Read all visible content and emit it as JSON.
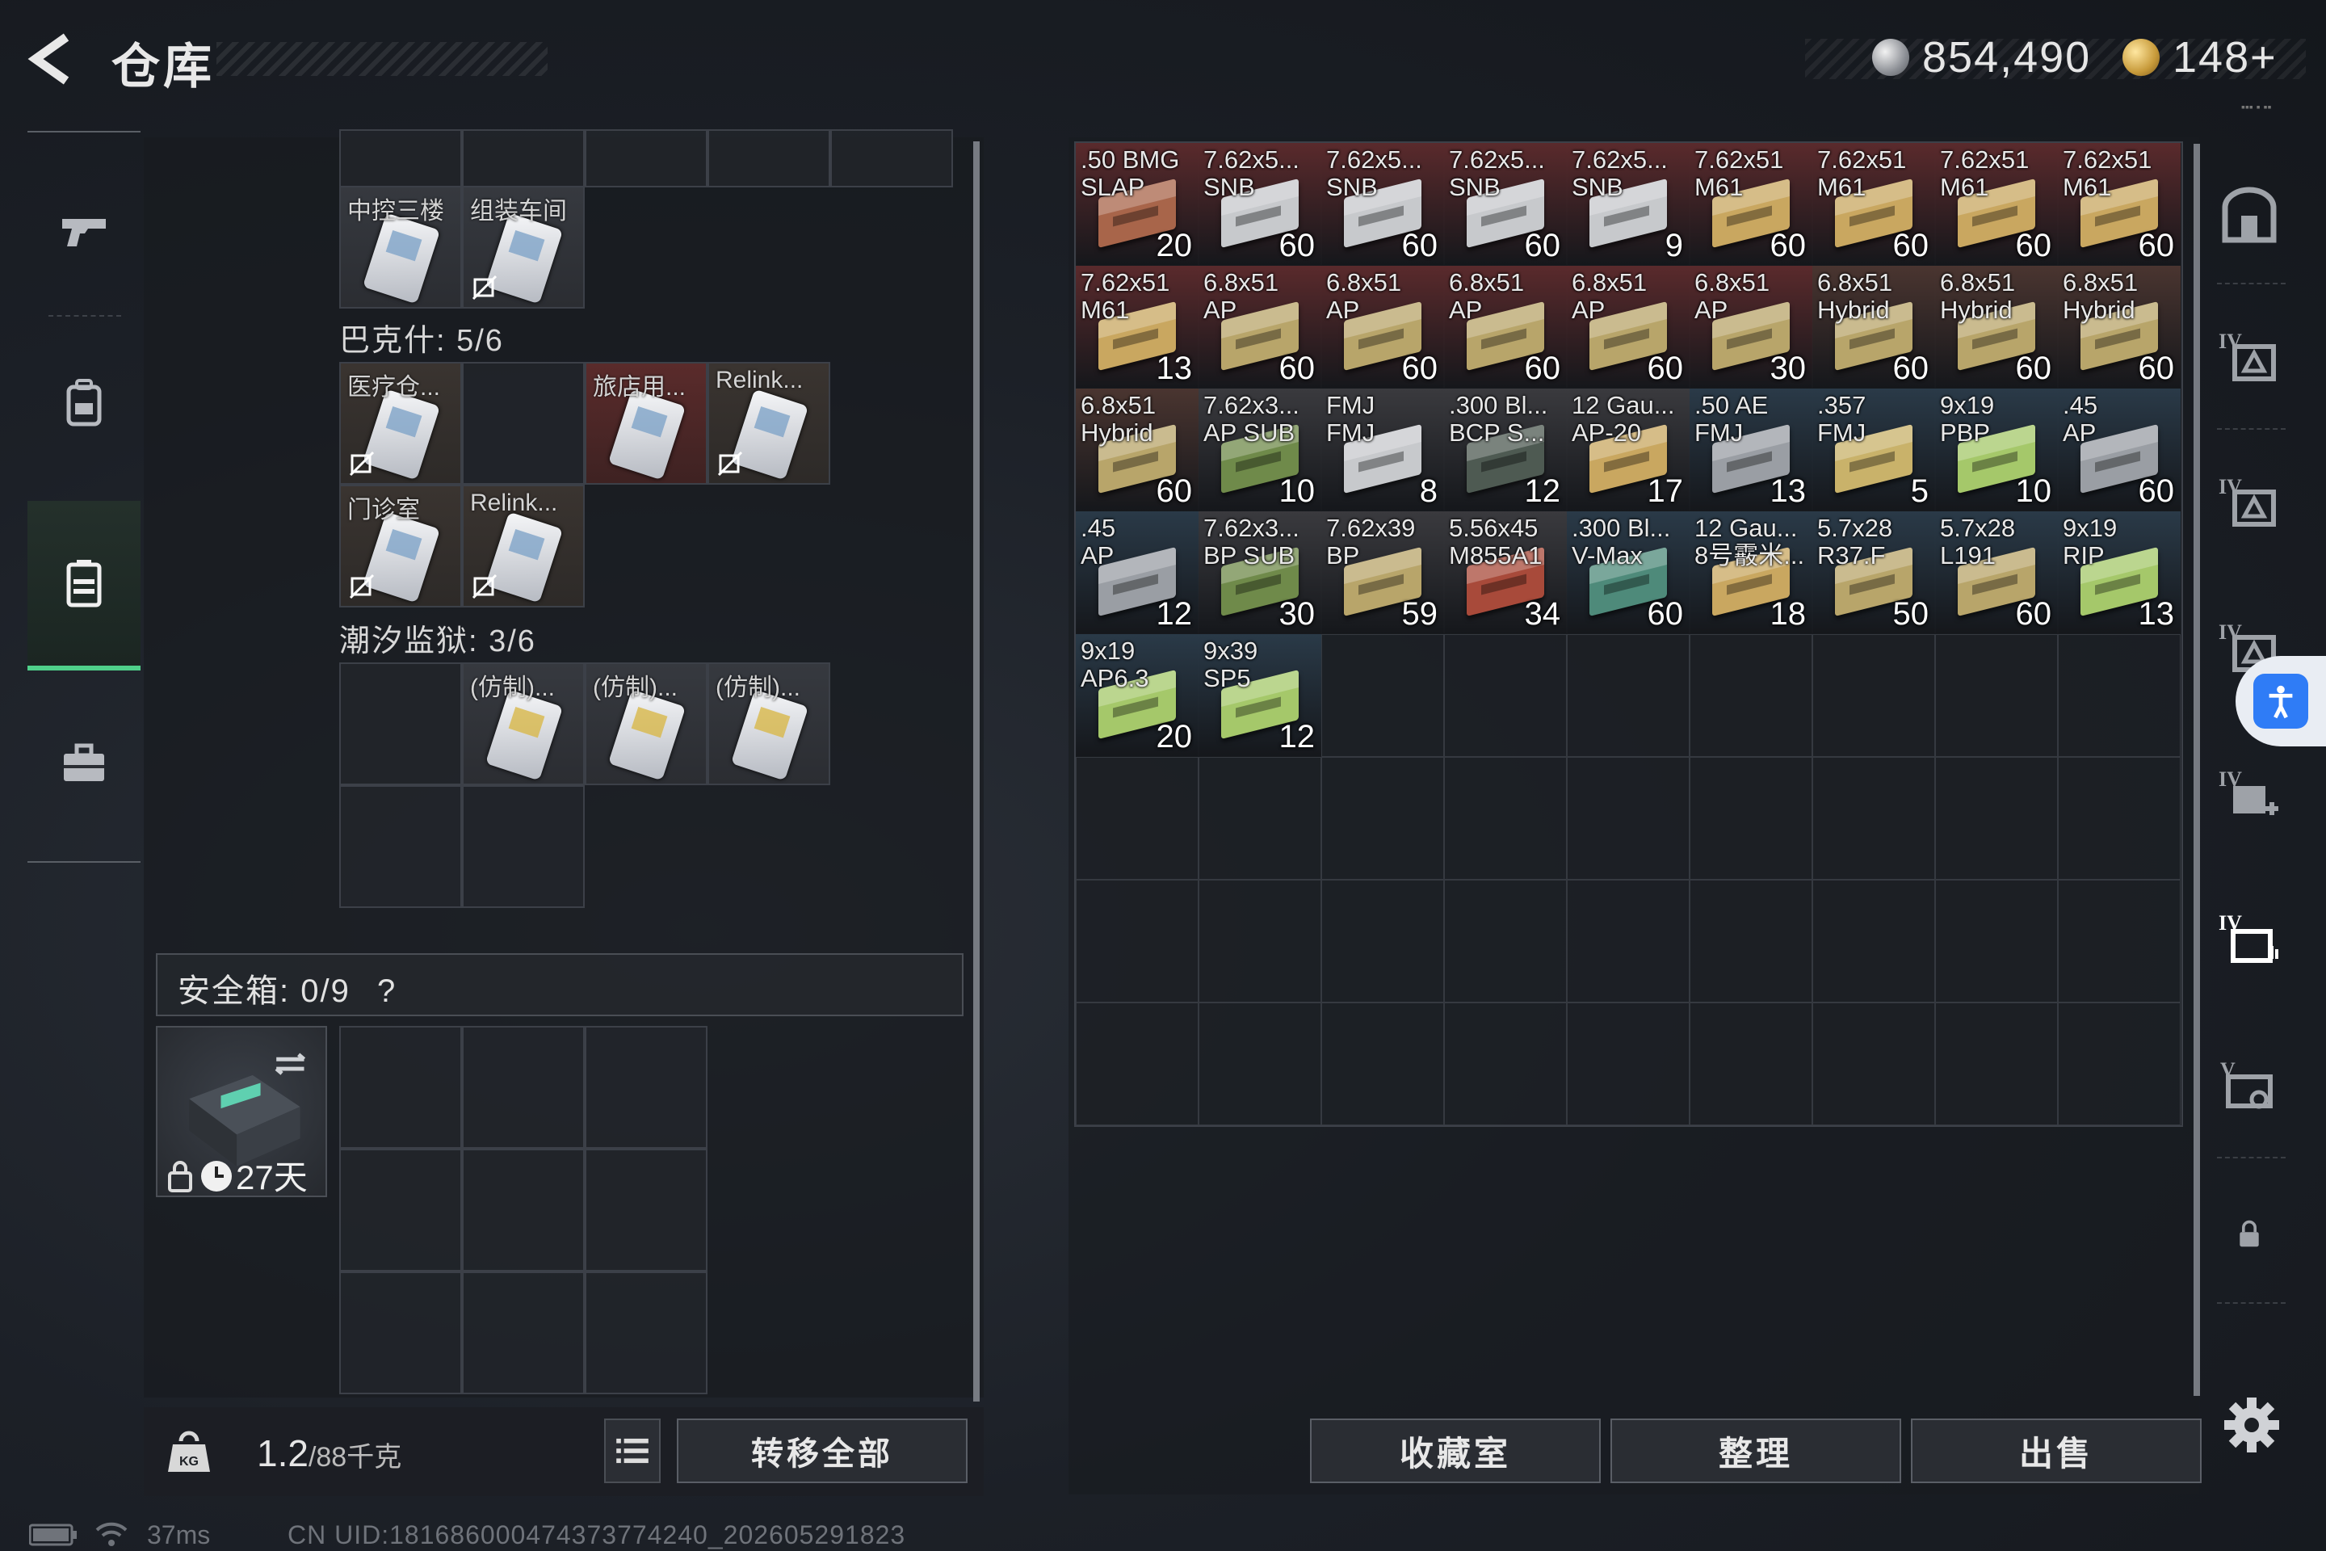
{
  "header": {
    "title": "仓库",
    "silver_currency": "854,490",
    "gold_currency": "148+",
    "corner_mark": "▪▪▪ ▪ ▪▪"
  },
  "colors": {
    "accent_green": "#4fd08a",
    "ammo_red": "#5a2a2c",
    "ammo_blue": "#2a3a48",
    "key_brown": "#3a3430",
    "accessibility_blue": "#2f7cf6"
  },
  "left_sidebar": {
    "tabs": [
      {
        "id": "weapons",
        "icon": "pistol-icon"
      },
      {
        "id": "equipment",
        "icon": "backpack-icon"
      },
      {
        "id": "storage",
        "icon": "storage-case-icon",
        "active": true
      },
      {
        "id": "toolbox",
        "icon": "toolbox-icon"
      }
    ]
  },
  "key_area": {
    "top_row": {
      "keys": [
        {
          "label": "中控三楼"
        },
        {
          "label": "组装车间"
        }
      ]
    },
    "bakeshi": {
      "label": "巴克什: 5/6",
      "keys": [
        {
          "label": "医疗仓..."
        },
        {
          "label": "旅店用..."
        },
        {
          "label": "Relink..."
        },
        {
          "label": "门诊室"
        },
        {
          "label": "Relink..."
        }
      ]
    },
    "tide_prison": {
      "label": "潮汐监狱: 3/6",
      "keys": [
        {
          "label": "(仿制)..."
        },
        {
          "label": "(仿制)..."
        },
        {
          "label": "(仿制)..."
        }
      ]
    }
  },
  "safe_box": {
    "label": "安全箱: 0/9",
    "help": "?",
    "days": "27天"
  },
  "bottom_left": {
    "weight_value": "1.2",
    "weight_unit": "/88千克",
    "transfer_all": "转移全部"
  },
  "status_bar": {
    "ping": "37ms",
    "uid": "CN UID:1816860004743737742​40_202605291823"
  },
  "ammo": [
    {
      "name": ".50 BMG\nSLAP",
      "qty": "20",
      "bg": "#5a2a2c",
      "box": "#a8654a"
    },
    {
      "name": "7.62x5...\nSNB",
      "qty": "60",
      "bg": "#5a2a2c",
      "box": "#c7c9cc"
    },
    {
      "name": "7.62x5...\nSNB",
      "qty": "60",
      "bg": "#5a2a2c",
      "box": "#c7c9cc"
    },
    {
      "name": "7.62x5...\nSNB",
      "qty": "60",
      "bg": "#5a2a2c",
      "box": "#c7c9cc"
    },
    {
      "name": "7.62x5...\nSNB",
      "qty": "9",
      "bg": "#5a2a2c",
      "box": "#c7c9cc"
    },
    {
      "name": "7.62x51\nM61",
      "qty": "60",
      "bg": "#5a2a2c",
      "box": "#c9a760"
    },
    {
      "name": "7.62x51\nM61",
      "qty": "60",
      "bg": "#5a2a2c",
      "box": "#c9a760"
    },
    {
      "name": "7.62x51\nM61",
      "qty": "60",
      "bg": "#5a2a2c",
      "box": "#c9a760"
    },
    {
      "name": "7.62x51\nM61",
      "qty": "60",
      "bg": "#5a2a2c",
      "box": "#c9a760"
    },
    {
      "name": "7.62x51\nM61",
      "qty": "13",
      "bg": "#5a2a2c",
      "box": "#c9a760"
    },
    {
      "name": "6.8x51\nAP",
      "qty": "60",
      "bg": "#5a2a2c",
      "box": "#b8a56a"
    },
    {
      "name": "6.8x51\nAP",
      "qty": "60",
      "bg": "#5a2a2c",
      "box": "#b8a56a"
    },
    {
      "name": "6.8x51\nAP",
      "qty": "60",
      "bg": "#5a2a2c",
      "box": "#b8a56a"
    },
    {
      "name": "6.8x51\nAP",
      "qty": "60",
      "bg": "#5a2a2c",
      "box": "#b8a56a"
    },
    {
      "name": "6.8x51\nAP",
      "qty": "30",
      "bg": "#5a2a2c",
      "box": "#b8a56a"
    },
    {
      "name": "6.8x51\nHybrid",
      "qty": "60",
      "bg": "#4a3530",
      "box": "#b8a56a"
    },
    {
      "name": "6.8x51\nHybrid",
      "qty": "60",
      "bg": "#4a3530",
      "box": "#b8a56a"
    },
    {
      "name": "6.8x51\nHybrid",
      "qty": "60",
      "bg": "#4a3530",
      "box": "#b8a56a"
    },
    {
      "name": "6.8x51\nHybrid",
      "qty": "60",
      "bg": "#4a3530",
      "box": "#b8a56a"
    },
    {
      "name": "7.62x3...\nAP SUB",
      "qty": "10",
      "bg": "#3a3a3e",
      "box": "#6f8a4a"
    },
    {
      "name": "FMJ\nFMJ",
      "qty": "8",
      "bg": "#3a3a3e",
      "box": "#c7c9cc"
    },
    {
      "name": ".300 Bl...\nBCP S...",
      "qty": "12",
      "bg": "#3a3a3e",
      "box": "#4e5a52"
    },
    {
      "name": "12 Gau...\nAP-20",
      "qty": "17",
      "bg": "#3a3a3e",
      "box": "#c9a760"
    },
    {
      "name": ".50 AE\nFMJ",
      "qty": "13",
      "bg": "#2a3a48",
      "box": "#9a9ea4"
    },
    {
      "name": ".357\nFMJ",
      "qty": "5",
      "bg": "#2a3a48",
      "box": "#c9b26a"
    },
    {
      "name": "9x19\nPBP",
      "qty": "10",
      "bg": "#2a3a48",
      "box": "#a5c86a"
    },
    {
      "name": ".45\nAP",
      "qty": "60",
      "bg": "#2a3a48",
      "box": "#9a9ea4"
    },
    {
      "name": ".45\nAP",
      "qty": "12",
      "bg": "#2a3a48",
      "box": "#9a9ea4"
    },
    {
      "name": "7.62x3...\nBP SUB",
      "qty": "30",
      "bg": "#3a3a3e",
      "box": "#6f8a4a"
    },
    {
      "name": "7.62x39\nBP",
      "qty": "59",
      "bg": "#3a3a3e",
      "box": "#b8a56a"
    },
    {
      "name": "5.56x45\nM855A1",
      "qty": "34",
      "bg": "#3a3a3e",
      "box": "#a84a3a"
    },
    {
      "name": ".300 Bl...\nV-Max",
      "qty": "60",
      "bg": "#2a3a48",
      "box": "#4e8a7a"
    },
    {
      "name": "12 Gau...\n8号霰米...",
      "qty": "18",
      "bg": "#2a3a48",
      "box": "#c9a760"
    },
    {
      "name": "5.7x28\nR37.F",
      "qty": "50",
      "bg": "#2a3a48",
      "box": "#b8a56a"
    },
    {
      "name": "5.7x28\nL191",
      "qty": "60",
      "bg": "#2a3a48",
      "box": "#b8a56a"
    },
    {
      "name": "9x19\nRIP",
      "qty": "13",
      "bg": "#2a3a48",
      "box": "#a5c86a"
    },
    {
      "name": "9x19\nAP6.3",
      "qty": "20",
      "bg": "#2a3a48",
      "box": "#a5c86a"
    },
    {
      "name": "9x39\nSP5",
      "qty": "12",
      "bg": "#2a3a48",
      "box": "#a5c86a"
    }
  ],
  "right_sidebar": {
    "tabs": [
      {
        "icon": "vault-icon"
      },
      {
        "icon": "tier4-armor-icon",
        "tier": "IV"
      },
      {
        "icon": "tier4-armor-icon",
        "tier": "IV"
      },
      {
        "icon": "tier4-armor-icon",
        "tier": "IV"
      },
      {
        "icon": "tier4-medkit-icon",
        "tier": "IV"
      },
      {
        "icon": "tier4-ammo-case-icon",
        "tier": "IV"
      },
      {
        "icon": "tier5-keycard-icon",
        "tier": "V"
      },
      {
        "icon": "lock-icon"
      }
    ]
  },
  "bottom_right": {
    "collection": "收藏室",
    "organize": "整理",
    "sell": "出售"
  }
}
